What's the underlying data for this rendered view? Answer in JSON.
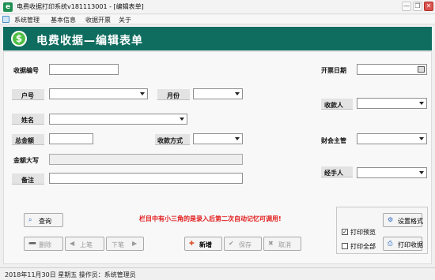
{
  "window": {
    "title": "电费收据打印系统v181113001 - [编辑表单]",
    "app_icon": "e",
    "minimize_icon": "—",
    "restore_icon": "❐",
    "close_icon": "✕"
  },
  "menu": {
    "items": [
      "系统管理",
      "基本信息",
      "收据开票",
      "关于"
    ]
  },
  "banner": {
    "icon": "$",
    "title": "电费收据—编辑表单"
  },
  "form": {
    "receipt_no": {
      "label": "收据编号",
      "value": ""
    },
    "account_no": {
      "label": "户号",
      "value": ""
    },
    "month": {
      "label": "月份",
      "value": ""
    },
    "name": {
      "label": "姓名",
      "value": ""
    },
    "total": {
      "label": "总金额",
      "value": ""
    },
    "pay_method": {
      "label": "收款方式",
      "value": ""
    },
    "amount_words": {
      "label": "金额大写",
      "value": ""
    },
    "note": {
      "label": "备注",
      "value": ""
    },
    "issue_date": {
      "label": "开票日期",
      "value": ""
    },
    "payee": {
      "label": "收款人",
      "value": ""
    },
    "finance": {
      "label": "财会主管",
      "value": ""
    },
    "handler": {
      "label": "经手人",
      "value": ""
    }
  },
  "buttons": {
    "query": "查询",
    "settings": "设置格式",
    "delete": "删除",
    "prev": "上笔",
    "next": "下笔",
    "add": "新增",
    "save": "保存",
    "cancel": "取消",
    "print": "打印收据"
  },
  "hint": "栏目中有小三角的是录入后第二次自动记忆可调用!",
  "options": {
    "preview": {
      "label": "打印预览",
      "checked": true
    },
    "second": {
      "label": "打印全部",
      "checked": false
    }
  },
  "status": "2018年11月30日  星期五  操作员：系统管理员",
  "colors": {
    "banner": "#0f6d5f",
    "hint": "#e21b1b",
    "add_icon": "#d9522b"
  }
}
